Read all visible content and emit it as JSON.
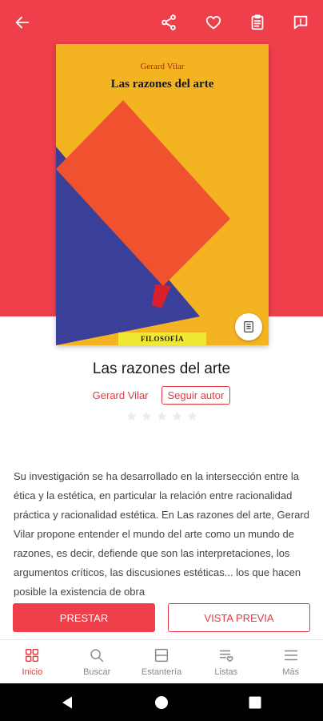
{
  "header": {
    "back_icon": "arrow-left-icon",
    "actions": [
      "share-icon",
      "heart-icon",
      "clipboard-icon",
      "report-icon"
    ]
  },
  "colors": {
    "accent": "#ee3f4b",
    "text_accent": "#e5393f"
  },
  "cover": {
    "author": "Gerard Vilar",
    "title": "Las razones del arte",
    "series": "FILOSOFÍA",
    "preview_icon": "book-preview-icon"
  },
  "book": {
    "title": "Las razones del arte",
    "author": "Gerard Vilar",
    "follow_label": "Seguir autor",
    "rating": 0,
    "max_rating": 5
  },
  "description": "Su investigación se ha desarrollado en la intersección entre la ética y la estética, en particular la relación entre racionalidad práctica y racionalidad estética. En Las razones del arte, Gerard Vilar propone entender el mundo del arte como un mundo de razones, es decir, defiende que son las interpretaciones, los argumentos críticos, las discusiones estéticas... los que hacen posible la existencia de obra",
  "actions": {
    "borrow_label": "PRESTAR",
    "preview_label": "VISTA PREVIA"
  },
  "bottom_nav": [
    {
      "label": "Inicio",
      "icon": "home-grid-icon",
      "active": true
    },
    {
      "label": "Buscar",
      "icon": "search-icon",
      "active": false
    },
    {
      "label": "Estantería",
      "icon": "shelf-icon",
      "active": false
    },
    {
      "label": "Listas",
      "icon": "list-heart-icon",
      "active": false
    },
    {
      "label": "Más",
      "icon": "menu-icon",
      "active": false
    }
  ]
}
